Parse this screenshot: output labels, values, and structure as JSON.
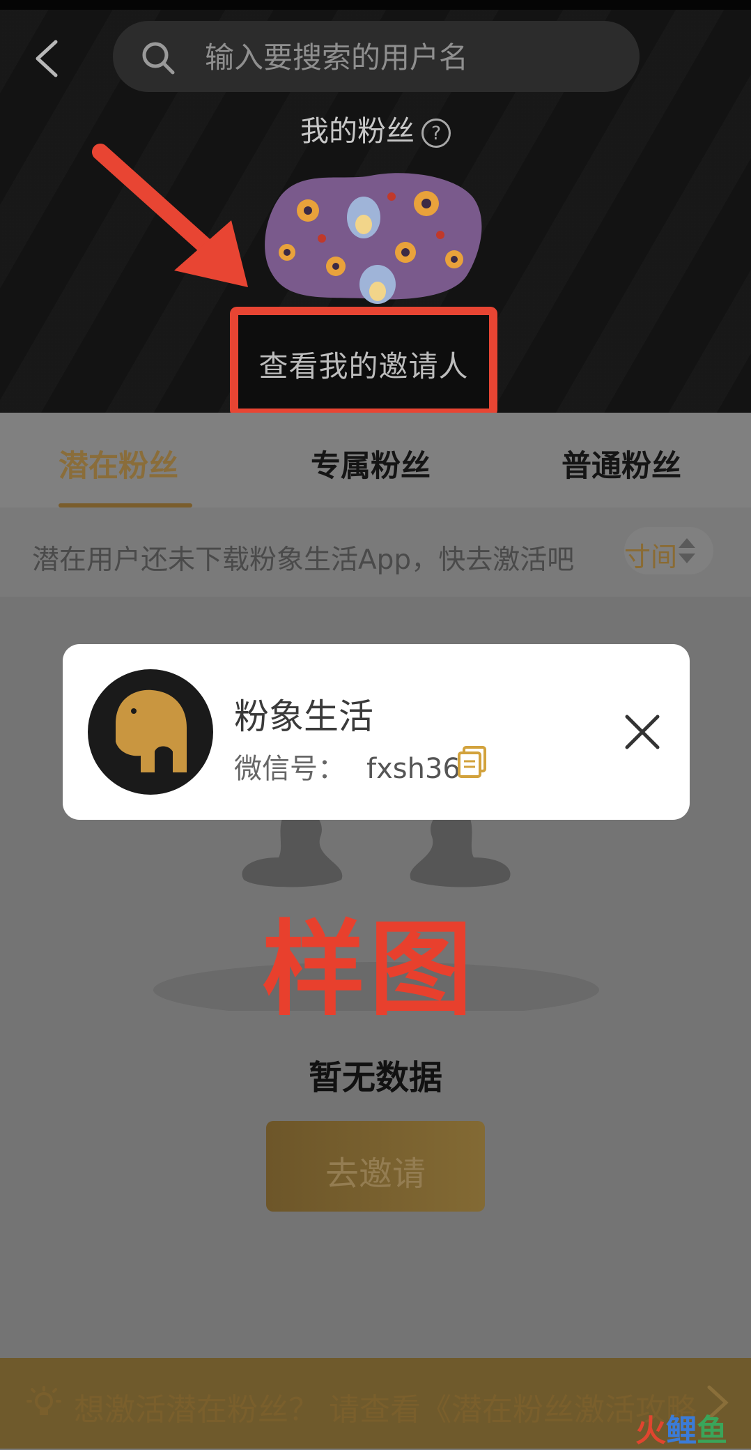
{
  "search": {
    "placeholder": "输入要搜索的用户名"
  },
  "header": {
    "title": "我的粉丝",
    "help_glyph": "?",
    "inviter_button": "查看我的邀请人"
  },
  "tabs": [
    {
      "label": "潜在粉丝",
      "active": true
    },
    {
      "label": "专属粉丝",
      "active": false
    },
    {
      "label": "普通粉丝",
      "active": false
    }
  ],
  "notice": {
    "text": "潜在用户还未下载粉象生活App，快去激活吧",
    "sort_label": "寸间"
  },
  "empty_state": {
    "sample_label": "样图",
    "message": "暂无数据",
    "invite_button": "去邀请"
  },
  "popup": {
    "name": "粉象生活",
    "wechat_label": "微信号：",
    "wechat_id": "fxsh36"
  },
  "bottom_bar": {
    "text": "想激活潜在粉丝？ 请查看《潜在粉丝激活攻略"
  },
  "watermark": {
    "part1": "火",
    "part2": "鲤",
    "part3": "鱼"
  },
  "colors": {
    "accent_gold": "#8a6d3a",
    "highlight_red": "#e84533",
    "header_bg": "#131313"
  }
}
